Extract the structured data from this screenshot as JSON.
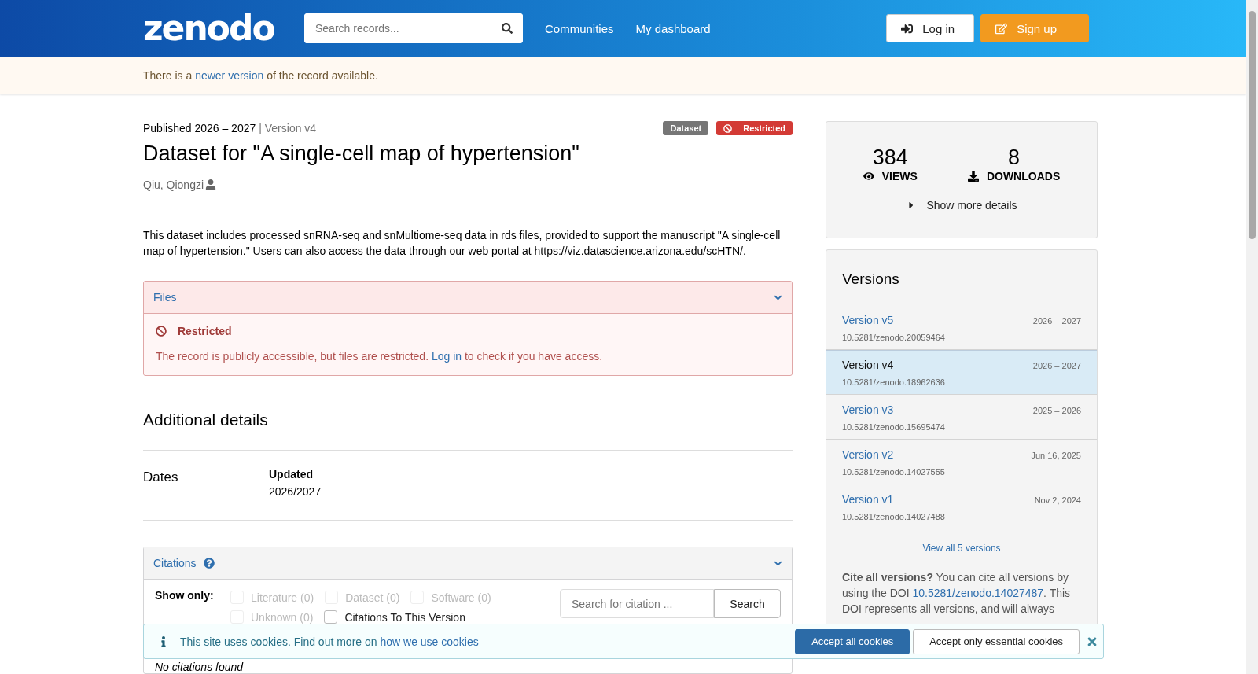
{
  "header": {
    "logo": "zenodo",
    "search": {
      "placeholder": "Search records..."
    },
    "nav": [
      "Communities",
      "My dashboard"
    ],
    "login": "Log in",
    "signup": "Sign up"
  },
  "notice": {
    "before": "There is a",
    "link": "newer version",
    "after": "of the record available."
  },
  "record": {
    "published": "Published 2026 – 2027",
    "version": "| Version v4",
    "badges": [
      {
        "kind": "type",
        "label": "Dataset"
      },
      {
        "kind": "access",
        "label": "Restricted"
      }
    ],
    "title": "Dataset for \"A single-cell map of hypertension\"",
    "author": "Qiu, Qiongzi",
    "description": "This dataset includes processed snRNA-seq and snMultiome-seq data in rds files, provided to support the manuscript \"A single-cell map of hypertension.\" Users can also access the data through our web portal at https://viz.datascience.arizona.edu/scHTN/."
  },
  "files": {
    "title": "Files",
    "expanded": true,
    "status": "Restricted",
    "before": "The record is publicly accessible, but files are restricted.",
    "link": "Log in",
    "after": "to check if you have access."
  },
  "additional": {
    "heading": "Additional details",
    "rows": [
      {
        "label": "Dates",
        "term": "Updated",
        "value": "2026/2027"
      }
    ]
  },
  "citations": {
    "title": "Citations",
    "filter_label": "Show only:",
    "filters": [
      {
        "label": "Literature (0)",
        "checked": false,
        "disabled": true
      },
      {
        "label": "Dataset (0)",
        "checked": false,
        "disabled": true
      },
      {
        "label": "Software (0)",
        "checked": false,
        "disabled": true
      },
      {
        "label": "Unknown (0)",
        "checked": false,
        "disabled": true
      },
      {
        "label": "Citations To This Version",
        "checked": false,
        "disabled": false
      }
    ],
    "search": {
      "placeholder": "Search for citation ..."
    },
    "search_button": "Search",
    "empty": "No citations found"
  },
  "stats": {
    "items": [
      {
        "kind": "views",
        "value": "384",
        "label": "VIEWS"
      },
      {
        "kind": "downloads",
        "value": "8",
        "label": "DOWNLOADS"
      }
    ],
    "more": "Show more details"
  },
  "versions": {
    "title": "Versions",
    "items": [
      {
        "label": "Version v5",
        "date": "2026 – 2027",
        "doi": "10.5281/zenodo.20059464",
        "selected": false
      },
      {
        "label": "Version v4",
        "date": "2026 – 2027",
        "doi": "10.5281/zenodo.18962636",
        "selected": true
      },
      {
        "label": "Version v3",
        "date": "2025 – 2026",
        "doi": "10.5281/zenodo.15695474",
        "selected": false
      },
      {
        "label": "Version v2",
        "date": "Jun 16, 2025",
        "doi": "10.5281/zenodo.14027555",
        "selected": false
      },
      {
        "label": "Version v1",
        "date": "Nov 2, 2024",
        "doi": "10.5281/zenodo.14027488",
        "selected": false
      }
    ],
    "view_all": "View all 5 versions",
    "cite_bold": "Cite all versions?",
    "cite_before": "You can cite all versions by using the DOI",
    "cite_link": "10.5281/zenodo.14027487",
    "cite_after": ". This DOI represents all versions, and will always"
  },
  "cookies": {
    "before": "This site uses cookies. Find out more on",
    "link": "how we use cookies",
    "accept_all": "Accept all cookies",
    "accept_essential": "Accept only essential cookies"
  }
}
